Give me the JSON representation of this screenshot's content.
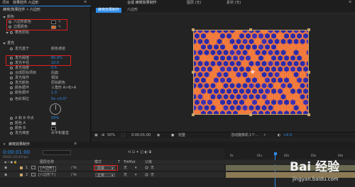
{
  "colors": {
    "accent_blue": "#2d8ceb",
    "highlight_red": "#e21d1d",
    "canvas_blue": "#2b2aa8",
    "canvas_orange": "#f07a3a",
    "swatch_black": "#000000",
    "swatch_orange": "#e56a1e",
    "layer_bar_olive": "#6b6a52",
    "layer_bar_tan": "#8b7a55"
  },
  "effect_panel": {
    "tab_label": "项目",
    "panel_title": "效果控件 六边形",
    "breadcrumb": "蜂窝/效果控件 • 六边形",
    "sections": {
      "colors": {
        "label": "颜色",
        "rows": [
          {
            "label": "六边形颜色",
            "swatch": "black"
          },
          {
            "label": "边框颜色",
            "swatch": "orange"
          },
          {
            "label": "着色原始",
            "value": ""
          }
        ]
      },
      "glow": {
        "label": "发光",
        "rows": [
          {
            "label": "发光基于",
            "value": "颜色通道"
          },
          {
            "label": "发光阈值",
            "value": "60.0%"
          },
          {
            "label": "发光半径",
            "value": "10.0"
          },
          {
            "label": "发光强度",
            "value": "0.5"
          },
          {
            "label": "合成原始项目",
            "value": "后面"
          },
          {
            "label": "发光操作",
            "value": "相加"
          },
          {
            "label": "发光颜色",
            "value": "原始颜色"
          },
          {
            "label": "颜色循环",
            "value": "三角形 A>B>A"
          },
          {
            "label": "颜色循环",
            "value": "1.0"
          },
          {
            "label": "色彩相位",
            "value": "0x +0.0°"
          },
          {
            "label": "A 和 B 中点",
            "value": "50%"
          },
          {
            "label": "颜色 A",
            "value": ""
          },
          {
            "label": "颜色 B",
            "value": ""
          },
          {
            "label": "发光维度",
            "value": "水平和垂直"
          }
        ]
      }
    }
  },
  "viewer": {
    "tab_label": "合成 蜂窝效果制作",
    "sub_tab_active": "蜂窝效果制作",
    "sub_tab_other": "六边形",
    "layer_tab": "图层 (无)",
    "footage_tab": "素材 (无)",
    "bottom": {
      "zoom": "50%",
      "timecode": "0:00:01:00",
      "quality": "完整",
      "view": "活动摄像机",
      "views": "1个...",
      "exposure": "+0.0"
    }
  },
  "timeline": {
    "tab_label": "蜂窝效果制作",
    "timecode": "0:00:01:00",
    "frame_info": "00025 (25.00 fps)",
    "columns": [
      "图层名称",
      "模式",
      "T",
      "TrkMat",
      "父级"
    ],
    "layers": [
      {
        "index": "1",
        "name": "[六边形]",
        "mode": "屏幕",
        "trkmat": "无",
        "parent": "无"
      },
      {
        "index": "2",
        "name": "[六边形下]",
        "mode": "正常",
        "trkmat": "无",
        "parent": "无"
      }
    ],
    "ruler": [
      "0s",
      "01s",
      "02s",
      "03s",
      "04s"
    ]
  },
  "watermark": {
    "brand": "Bai 经验",
    "url": "jingyan.baidu.com"
  }
}
